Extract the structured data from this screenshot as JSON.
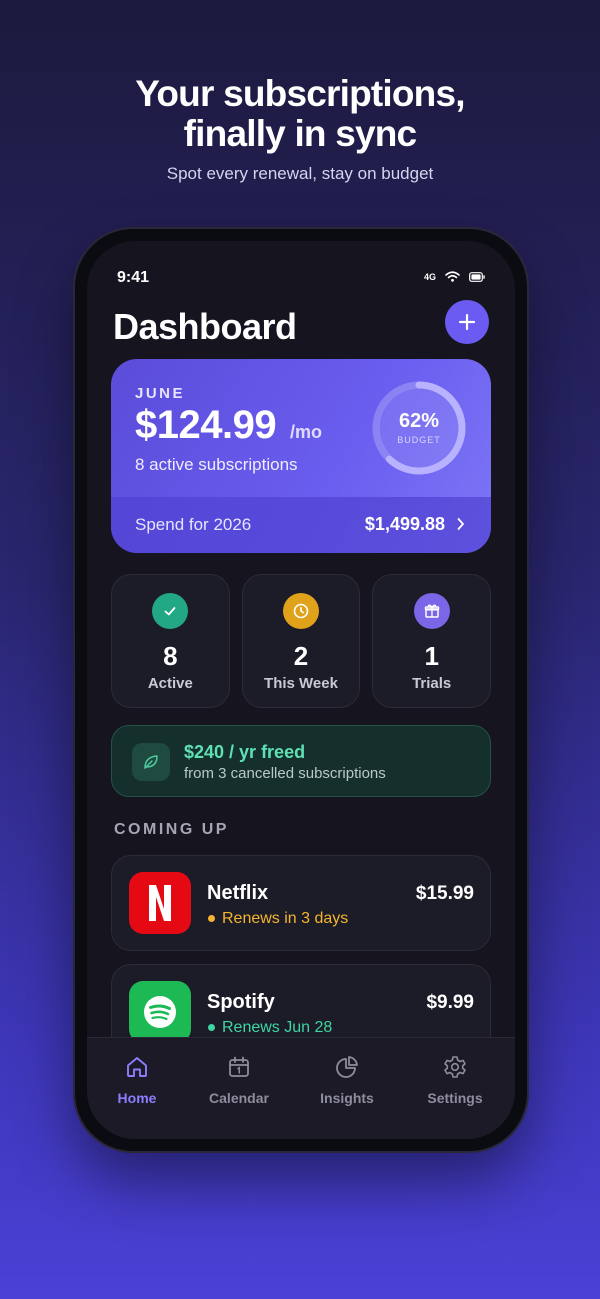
{
  "hero": {
    "title_line1": "Your subscriptions,",
    "title_line2": "finally in sync",
    "subtitle": "Spot every renewal, stay on budget"
  },
  "status_bar": {
    "time": "9:41",
    "network": "4G"
  },
  "header": {
    "title": "Dashboard",
    "add_icon": "plus-icon"
  },
  "summary": {
    "month": "JUNE",
    "amount": "$124.99",
    "per": "/mo",
    "active_text": "8 active subscriptions",
    "budget_percent": "62%",
    "budget_label": "BUDGET",
    "budget_fraction": 0.62,
    "yearly_label": "Spend for 2026",
    "yearly_value": "$1,499.88"
  },
  "stats": [
    {
      "value": "8",
      "label": "Active",
      "icon": "check-icon",
      "color": "#22a884"
    },
    {
      "value": "2",
      "label": "This Week",
      "icon": "clock-icon",
      "color": "#e0a21a"
    },
    {
      "value": "1",
      "label": "Trials",
      "icon": "gift-icon",
      "color": "#7b66e8"
    }
  ],
  "freed": {
    "title": "$240 / yr freed",
    "subtitle": "from 3 cancelled subscriptions",
    "icon": "leaf-icon"
  },
  "coming_up": {
    "heading": "COMING UP",
    "items": [
      {
        "name": "Netflix",
        "renew": "Renews in 3 days",
        "price": "$15.99",
        "logo": "netflix-logo",
        "logo_color": "#e50914",
        "status_color": "#f5b52e"
      },
      {
        "name": "Spotify",
        "renew": "Renews Jun 28",
        "price": "$9.99",
        "logo": "spotify-logo",
        "logo_color": "#1db954",
        "status_color": "#3ed6a0"
      }
    ]
  },
  "tabs": [
    {
      "label": "Home",
      "icon": "home-icon",
      "active": true
    },
    {
      "label": "Calendar",
      "icon": "calendar-icon",
      "active": false
    },
    {
      "label": "Insights",
      "icon": "pie-chart-icon",
      "active": false
    },
    {
      "label": "Settings",
      "icon": "gear-icon",
      "active": false
    }
  ],
  "colors": {
    "accent": "#6b5bf2",
    "background_top": "#1c1a3d",
    "background_bottom": "#4a41d6"
  }
}
